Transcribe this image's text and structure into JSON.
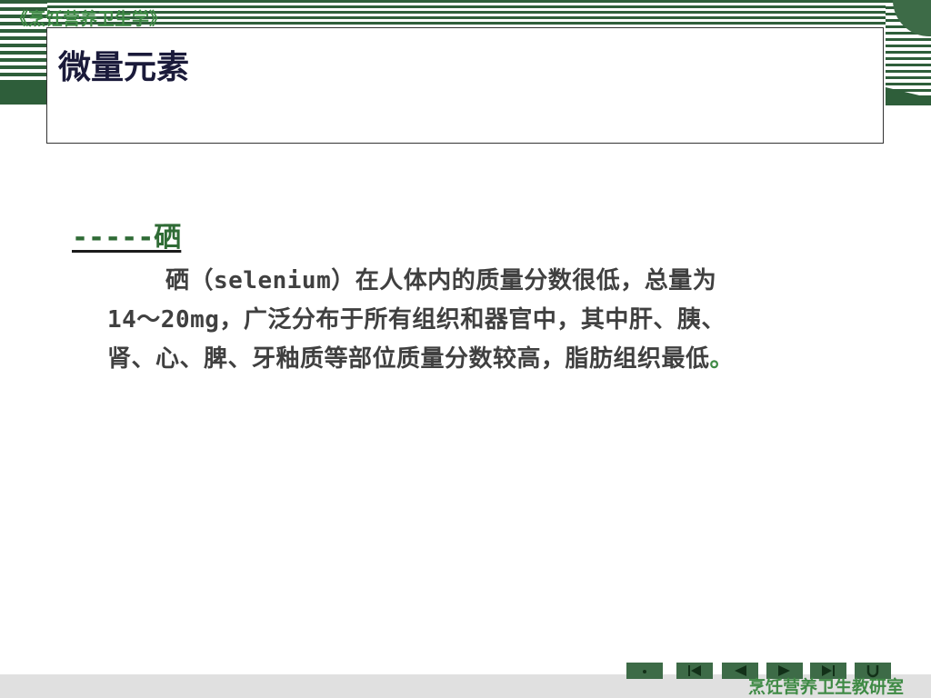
{
  "header": {
    "course_label": "《烹饪营养卫生学》"
  },
  "title": "微量元素",
  "section": {
    "heading": "-----硒",
    "paragraph_lines": [
      "硒（selenium）在人体内的质量分数很低，总量为",
      "14～20mg，广泛分布于所有组织和器官中，其中肝、胰、",
      "肾、心、脾、牙釉质等部位质量分数较高，脂肪组织最低"
    ],
    "final_period": "。"
  },
  "footer": {
    "department": "烹饪营养卫生教研室"
  },
  "nav_buttons": [
    {
      "icon": "home-icon"
    },
    {
      "icon": "first-slide-icon"
    },
    {
      "icon": "previous-slide-icon"
    },
    {
      "icon": "next-slide-icon"
    },
    {
      "icon": "last-slide-icon"
    },
    {
      "icon": "return-icon"
    }
  ],
  "colors": {
    "accent_green": "#3f8a45",
    "dark_green": "#2e5e3a",
    "title_text": "#1a1a3a",
    "body_text": "#404040"
  }
}
